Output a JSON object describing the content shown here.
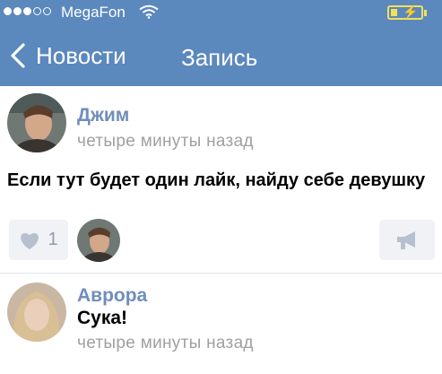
{
  "status_bar": {
    "carrier": "MegaFon",
    "signal_bars_filled": 3,
    "signal_bars_total": 5
  },
  "nav": {
    "back_label": "Новости",
    "title": "Запись"
  },
  "post": {
    "author": "Джим",
    "time": "четыре минуты назад",
    "text": "Если тут будет один лайк, найду себе девушку",
    "like_count": "1"
  },
  "comment": {
    "author": "Аврора",
    "text": "Сука!",
    "time": "четыре минуты назад"
  },
  "colors": {
    "header": "#5b88bd",
    "name": "#6f8ebb",
    "muted": "#a0a0a0",
    "battery": "#f2e05c"
  },
  "icons": [
    "wifi-icon",
    "battery-icon",
    "chevron-left-icon",
    "heart-icon",
    "megaphone-icon"
  ]
}
